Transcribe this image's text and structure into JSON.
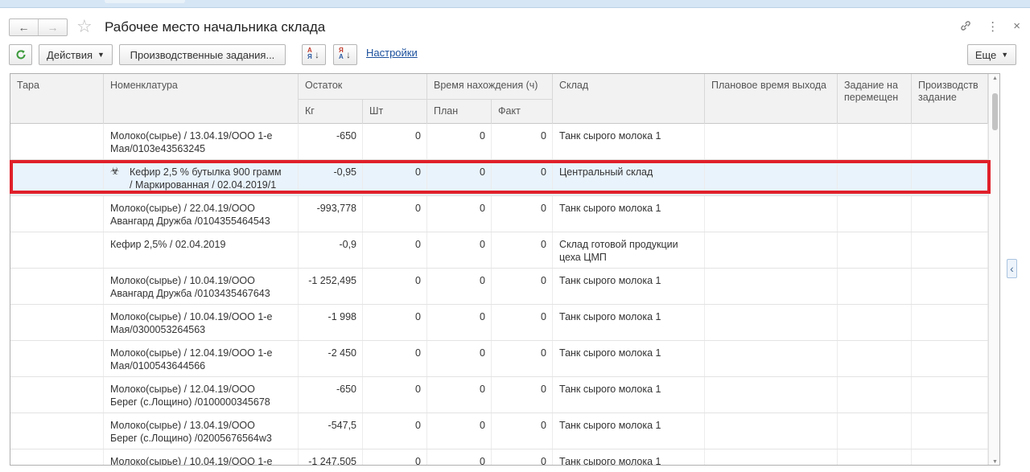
{
  "window": {
    "title": "Рабочее место начальника склада",
    "nav_back": "←",
    "nav_forward": "→",
    "favorite": "☆",
    "link_icon": "🔗",
    "menu_icon": "⋮",
    "close_icon": "×"
  },
  "toolbar": {
    "refresh": "C",
    "actions_label": "Действия",
    "production_label": "Производственные задания...",
    "settings_link": "Настройки",
    "more_label": "Еще",
    "sort_a": "А",
    "sort_z": "Я",
    "sort_arrow": "↓"
  },
  "table": {
    "headers": {
      "tara": "Тара",
      "nomenclature": "Номенклатура",
      "remainder": "Остаток",
      "kg": "Кг",
      "pcs": "Шт",
      "time": "Время нахождения (ч)",
      "plan": "План",
      "fact": "Факт",
      "warehouse": "Склад",
      "planned_exit": "Плановое время выхода",
      "move_task": "Задание на перемещен",
      "prod_task": "Производств задание"
    },
    "rows": [
      {
        "nom1": "Молоко(сырье) / 13.04.19/ООО 1-е",
        "nom2": "Мая/0103e43563245",
        "kg": "-650",
        "pcs": "0",
        "plan": "0",
        "fact": "0",
        "wh1": "Танк сырого молока 1",
        "wh2": ""
      },
      {
        "nom1": "Кефир 2,5 % бутылка 900 грамм",
        "nom2": "/ Маркированная / 02.04.2019/1",
        "kg": "-0,95",
        "pcs": "0",
        "plan": "0",
        "fact": "0",
        "wh1": "Центральный склад",
        "wh2": ""
      },
      {
        "nom1": "Молоко(сырье) / 22.04.19/ООО",
        "nom2": "Авангард Дружба  /0104355464543",
        "kg": "-993,778",
        "pcs": "0",
        "plan": "0",
        "fact": "0",
        "wh1": "Танк сырого молока 1",
        "wh2": ""
      },
      {
        "nom1": "Кефир 2,5% / 02.04.2019",
        "nom2": "",
        "kg": "-0,9",
        "pcs": "0",
        "plan": "0",
        "fact": "0",
        "wh1": "Склад готовой продукции",
        "wh2": "цеха ЦМП"
      },
      {
        "nom1": "Молоко(сырье) / 10.04.19/ООО",
        "nom2": "Авангард Дружба  /0103435467643",
        "kg": "-1 252,495",
        "pcs": "0",
        "plan": "0",
        "fact": "0",
        "wh1": "Танк сырого молока 1",
        "wh2": ""
      },
      {
        "nom1": "Молоко(сырье) / 10.04.19/ООО 1-е",
        "nom2": "Мая/0300053264563",
        "kg": "-1 998",
        "pcs": "0",
        "plan": "0",
        "fact": "0",
        "wh1": "Танк сырого молока 1",
        "wh2": ""
      },
      {
        "nom1": "Молоко(сырье) / 12.04.19/ООО 1-е",
        "nom2": "Мая/0100543644566",
        "kg": "-2 450",
        "pcs": "0",
        "plan": "0",
        "fact": "0",
        "wh1": "Танк сырого молока 1",
        "wh2": ""
      },
      {
        "nom1": "Молоко(сырье) / 12.04.19/ООО",
        "nom2": "Берег (с.Лощино)  /0100000345678",
        "kg": "-650",
        "pcs": "0",
        "plan": "0",
        "fact": "0",
        "wh1": "Танк сырого молока 1",
        "wh2": ""
      },
      {
        "nom1": "Молоко(сырье) / 13.04.19/ООО",
        "nom2": "Берег (с.Лощино)  /02005676564w3",
        "kg": "-547,5",
        "pcs": "0",
        "plan": "0",
        "fact": "0",
        "wh1": "Танк сырого молока 1",
        "wh2": ""
      },
      {
        "nom1": "Молоко(сырье) / 10.04.19/ООО 1-е",
        "nom2": "",
        "kg": "-1 247,505",
        "pcs": "0",
        "plan": "0",
        "fact": "0",
        "wh1": "Танк сырого молока 1",
        "wh2": ""
      }
    ],
    "selected_row": 1,
    "bio_icon": "☣"
  },
  "side": {
    "collapse": "‹"
  }
}
